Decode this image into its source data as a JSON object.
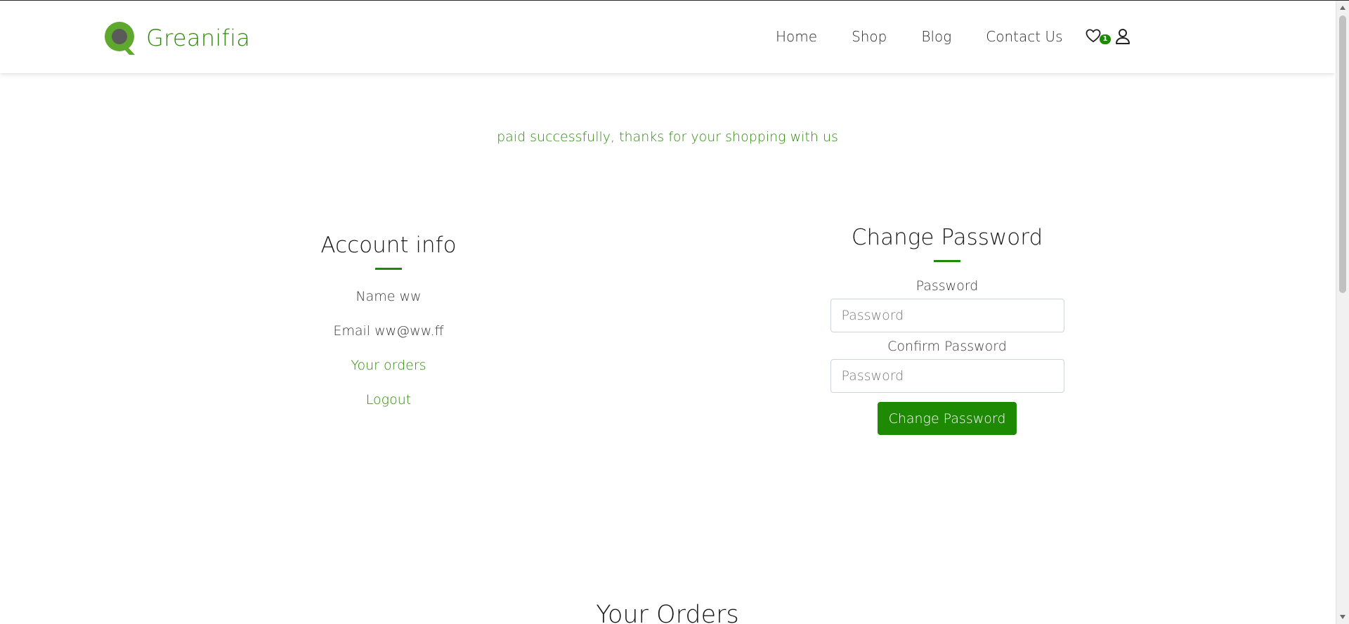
{
  "brand": {
    "name": "Greanifia",
    "primary_color": "#1e8a04",
    "text_green": "#2e8b0b"
  },
  "nav": {
    "links": [
      {
        "label": "Home"
      },
      {
        "label": "Shop"
      },
      {
        "label": "Blog"
      },
      {
        "label": "Contact Us"
      }
    ],
    "wishlist_icon": "heart-icon",
    "wishlist_count": "1",
    "user_icon": "user-icon"
  },
  "message": "paid successfully, thanks for your shopping with us",
  "account": {
    "title": "Account info",
    "name_line": "Name ww",
    "email_line": "Email ww@ww.ff",
    "orders_link": "Your orders",
    "logout_link": "Logout"
  },
  "change_password": {
    "title": "Change Password",
    "password_label": "Password",
    "password_placeholder": "Password",
    "confirm_label": "Confirm Password",
    "confirm_placeholder": "Password",
    "submit_label": "Change Password"
  },
  "orders": {
    "title": "Your Orders"
  }
}
